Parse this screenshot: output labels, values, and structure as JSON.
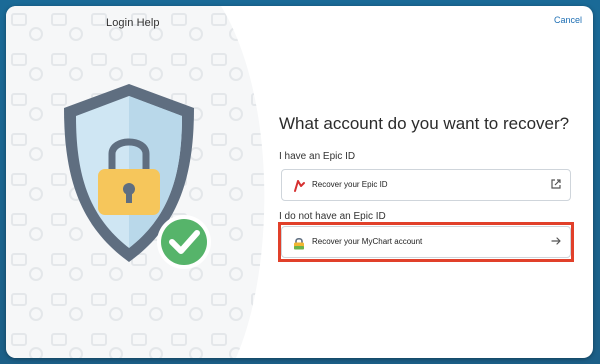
{
  "dialog": {
    "title": "Login Help",
    "cancel_label": "Cancel"
  },
  "main": {
    "heading": "What account do you want to recover?",
    "sections": [
      {
        "label": "I have an Epic ID",
        "option": {
          "label": "Recover your Epic ID",
          "icon": "epic-logo-icon",
          "action_icon": "external-link-icon"
        }
      },
      {
        "label": "I do not have an Epic ID",
        "option": {
          "label": "Recover your MyChart account",
          "icon": "mychart-lock-icon",
          "action_icon": "arrow-right-icon"
        }
      }
    ]
  },
  "illustration": {
    "icon": "security-shield-lock-check-icon"
  },
  "colors": {
    "accent_link": "#1e6fb4",
    "highlight_border": "#e1402a",
    "shield_fill": "#cfe6f3",
    "shield_border": "#5f6e80",
    "lock_body": "#f6c65b",
    "check_badge": "#56b46a"
  }
}
